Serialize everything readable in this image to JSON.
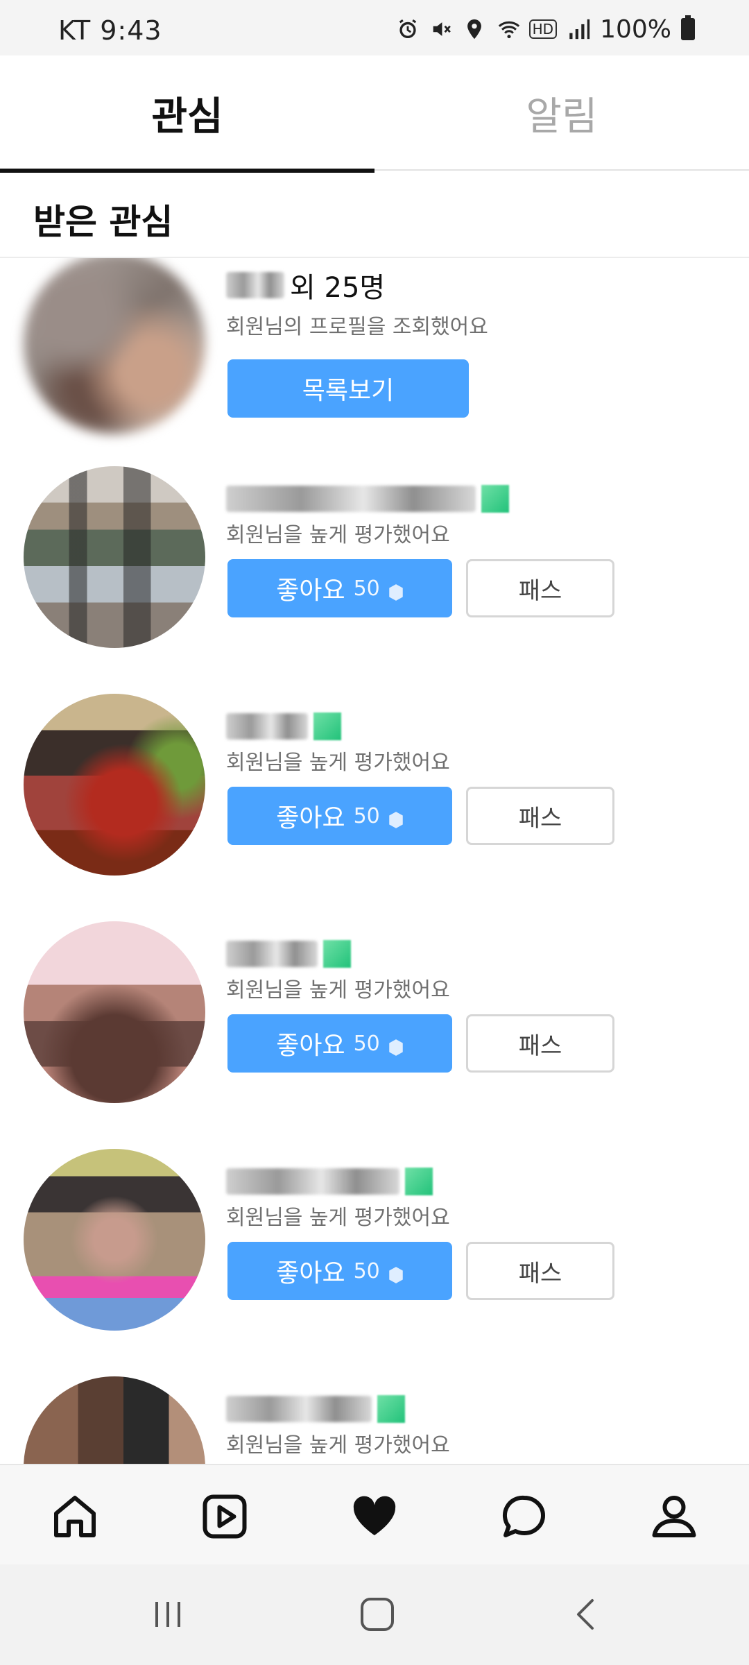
{
  "status_bar": {
    "carrier_time": "KT 9:43",
    "hd": "HD",
    "battery": "100%"
  },
  "tabs": [
    {
      "label": "관심",
      "active": true
    },
    {
      "label": "알림",
      "active": false
    }
  ],
  "section": {
    "title": "받은 관심"
  },
  "viewed": {
    "name_suffix": "외 25명",
    "description": "회원님의 프로필을 조회했어요",
    "button_label": "목록보기"
  },
  "rating_items": [
    {
      "description": "회원님을 높게 평가했어요",
      "like_label": "좋아요",
      "like_count": "50",
      "pass_label": "패스"
    },
    {
      "description": "회원님을 높게 평가했어요",
      "like_label": "좋아요",
      "like_count": "50",
      "pass_label": "패스"
    },
    {
      "description": "회원님을 높게 평가했어요",
      "like_label": "좋아요",
      "like_count": "50",
      "pass_label": "패스"
    },
    {
      "description": "회원님을 높게 평가했어요",
      "like_label": "좋아요",
      "like_count": "50",
      "pass_label": "패스"
    },
    {
      "description": "회원님을 높게 평가했어요"
    }
  ],
  "bottom_nav": [
    "home-icon",
    "play-icon",
    "heart-icon",
    "chat-icon",
    "profile-icon"
  ],
  "colors": {
    "accent": "#4aa3ff",
    "text": "#111111",
    "muted": "#707070"
  }
}
